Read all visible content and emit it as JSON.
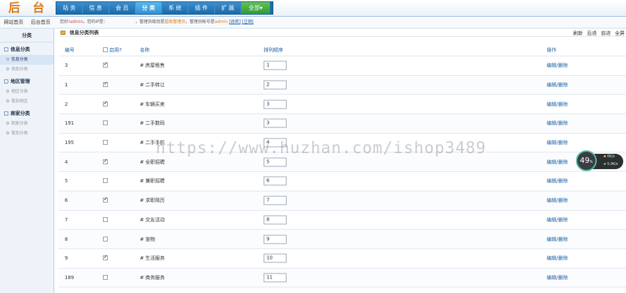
{
  "header": {
    "logo": "后 台",
    "nav": [
      {
        "label": "站 务",
        "active": false
      },
      {
        "label": "信 息",
        "active": false
      },
      {
        "label": "会 员",
        "active": false
      },
      {
        "label": "分 类",
        "active": true
      },
      {
        "label": "系 统",
        "active": false
      },
      {
        "label": "插 件",
        "active": false
      },
      {
        "label": "扩 展",
        "active": false
      },
      {
        "label": "全部▾",
        "active": false
      }
    ]
  },
  "subbar": {
    "link_site": "网站首页",
    "link_admin": "后台首页",
    "welcome_prefix": "您好!",
    "user": "admin",
    "welcome_mid": "。您的IP是：",
    "notice_a": "，管理员级别是",
    "notice_level": "超级管理员",
    "notice_b": "，管理员帐号是",
    "notice_user": "admin",
    "action_edit": "[改密]",
    "action_logout": "[注销]"
  },
  "sidebar": {
    "title": "分类",
    "groups": [
      {
        "title": "信息分类",
        "items": [
          {
            "label": "信息分类",
            "active": true
          },
          {
            "label": "添加分类",
            "active": false
          }
        ]
      },
      {
        "title": "地区管理",
        "items": [
          {
            "label": "地区分类",
            "active": false
          },
          {
            "label": "增加地区",
            "active": false
          }
        ]
      },
      {
        "title": "商家分类",
        "items": [
          {
            "label": "商家分类",
            "active": false
          },
          {
            "label": "增加分类",
            "active": false
          }
        ]
      }
    ]
  },
  "main": {
    "panel_title": "信息分类列表",
    "toolbar": [
      "刷新",
      "后退",
      "前进",
      "全屏"
    ],
    "table": {
      "headers": {
        "id": "编号",
        "enabled": "启用?",
        "name": "名称",
        "sort": "排列顺序",
        "ops": "操作"
      },
      "op_edit": "编辑",
      "op_sep": "/",
      "op_delete": "删除",
      "rows": [
        {
          "id": "3",
          "enabled": true,
          "name": "房屋租售",
          "sort": "1"
        },
        {
          "id": "1",
          "enabled": true,
          "name": "二手转让",
          "sort": "2"
        },
        {
          "id": "2",
          "enabled": true,
          "name": "车辆买卖",
          "sort": "3"
        },
        {
          "id": "191",
          "enabled": false,
          "name": "二手数码",
          "sort": "3"
        },
        {
          "id": "195",
          "enabled": false,
          "name": "二手手机",
          "sort": "4"
        },
        {
          "id": "4",
          "enabled": true,
          "name": "全职招聘",
          "sort": "5"
        },
        {
          "id": "5",
          "enabled": false,
          "name": "兼职招聘",
          "sort": "6"
        },
        {
          "id": "6",
          "enabled": true,
          "name": "求职简历",
          "sort": "7"
        },
        {
          "id": "7",
          "enabled": false,
          "name": "交友活动",
          "sort": "8"
        },
        {
          "id": "8",
          "enabled": false,
          "name": "宠物",
          "sort": "9"
        },
        {
          "id": "9",
          "enabled": true,
          "name": "生活服务",
          "sort": "10"
        },
        {
          "id": "189",
          "enabled": false,
          "name": "商务服务",
          "sort": "11"
        }
      ]
    }
  },
  "watermark": "https://www.huzhan.com/ishop3489",
  "speed_widget": {
    "percent": "49",
    "percent_sign": "%",
    "up": "0K/s",
    "down": "5.9K/s"
  }
}
